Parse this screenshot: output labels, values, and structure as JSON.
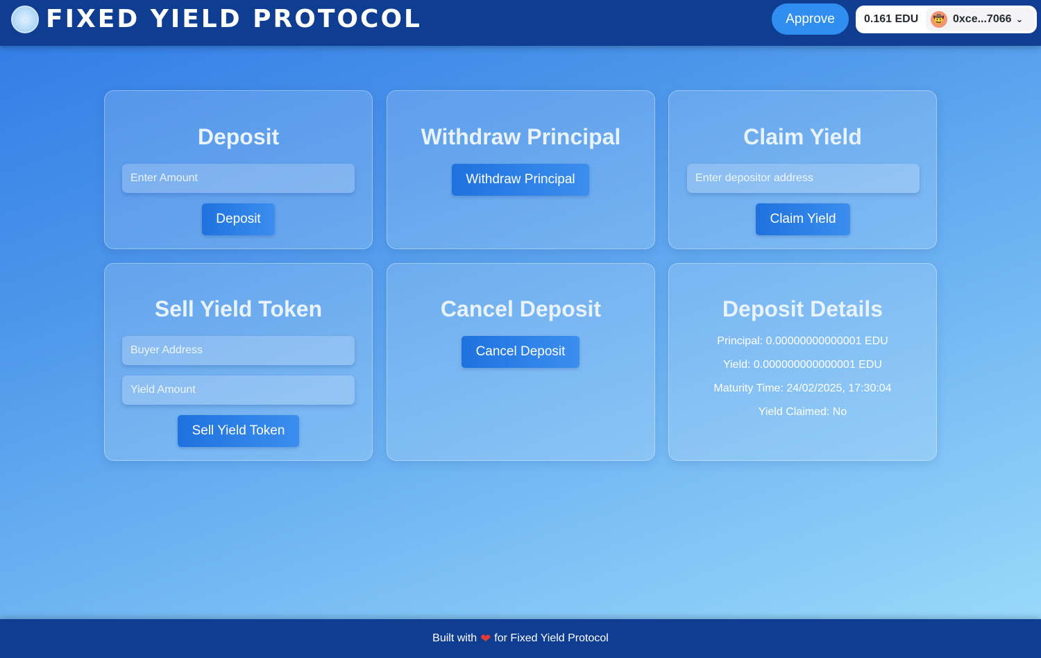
{
  "header": {
    "title": "FIXED YIELD PROTOCOL",
    "approve_label": "Approve",
    "wallet": {
      "balance": "0.161 EDU",
      "address": "0xce...7066",
      "avatar_emoji": "🤠"
    }
  },
  "cards": {
    "deposit": {
      "title": "Deposit",
      "amount_placeholder": "Enter Amount",
      "button": "Deposit"
    },
    "withdraw": {
      "title": "Withdraw Principal",
      "button": "Withdraw Principal"
    },
    "claim": {
      "title": "Claim Yield",
      "address_placeholder": "Enter depositor address",
      "button": "Claim Yield"
    },
    "sell": {
      "title": "Sell Yield Token",
      "buyer_placeholder": "Buyer Address",
      "amount_placeholder": "Yield Amount",
      "button": "Sell Yield Token"
    },
    "cancel": {
      "title": "Cancel Deposit",
      "button": "Cancel Deposit"
    },
    "details": {
      "title": "Deposit Details",
      "principal": "Principal: 0.00000000000001 EDU",
      "yield": "Yield: 0.000000000000001 EDU",
      "maturity": "Maturity Time: 24/02/2025, 17:30:04",
      "claimed": "Yield Claimed: No"
    }
  },
  "footer": {
    "prefix": "Built with",
    "suffix": "for Fixed Yield Protocol"
  },
  "colors": {
    "header_bg": "#0f3d91",
    "accent": "#2f8ef0",
    "heart": "#e53935"
  }
}
